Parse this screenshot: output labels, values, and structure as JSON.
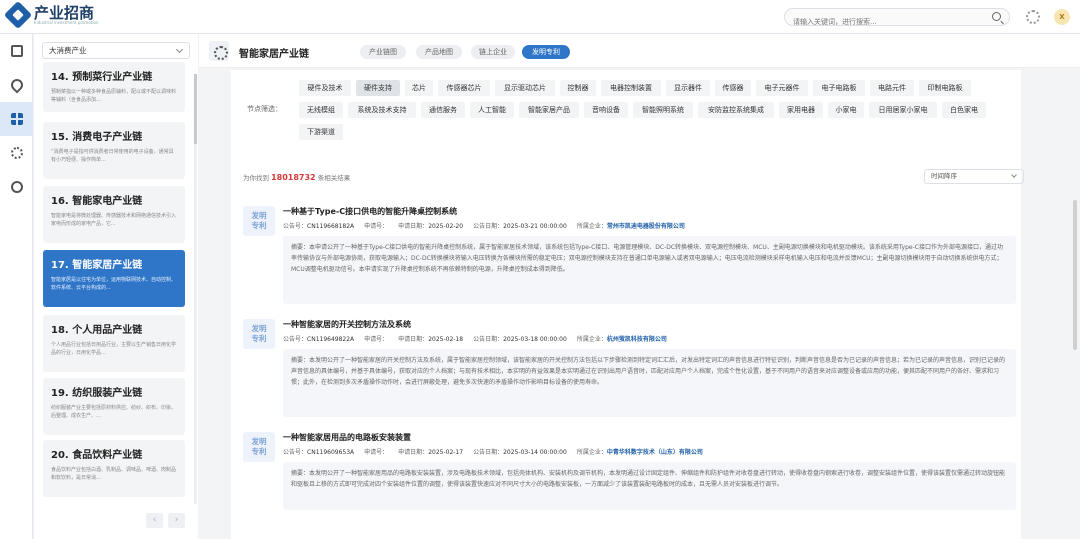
{
  "app": {
    "logo_title": "产业招商",
    "logo_subtitle": "Industrial investment promotion",
    "search_placeholder": "请输入关键词，进行搜索...",
    "avatar": "X"
  },
  "rail": {
    "icons": [
      "dashboard-icon",
      "map-pin-icon",
      "grid-icon",
      "network-icon",
      "eye-icon"
    ],
    "active_index": 2
  },
  "left": {
    "industry_select": "大消费产业",
    "cards": [
      {
        "title": "14. 预制菜行业产业链",
        "desc": "预制菜指以一种或多种食品原辅料，配以或不配以调味料等辅料（含食品添加..."
      },
      {
        "title": "15. 消费电子产业链",
        "desc": "“消费电子是指可供消费者日常使用的电子设备，通常具有小巧轻便、操作简单..."
      },
      {
        "title": "16. 智能家电产业链",
        "desc": "智能家电是将微处理器、传感器技术和网络通信技术引入家电而形成的家电产品，它..."
      },
      {
        "title": "17. 智能家居产业链",
        "desc": "智能家居是以住宅为单位，运用物联网技术、自动控制、软件系统、云平台构成的..."
      },
      {
        "title": "18. 个人用品产业链",
        "desc": "个人用品行业包括日用品行业，主要以生产销售日用化学品的行业，日用化学品..."
      },
      {
        "title": "19. 纺织服装产业链",
        "desc": "纺织服装产业主要包括原材料供应、纺纱、织布、印染、后整理、成衣生产、..."
      },
      {
        "title": "20. 食品饮料产业链",
        "desc": "食品饮料产业包括白酒、乳制品、调味品、啤酒、肉制品和软饮料，是日常消..."
      }
    ],
    "active_card": 3,
    "prev": "‹",
    "next": "›"
  },
  "main": {
    "title": "智能家居产业链",
    "tabs": [
      "产业链图",
      "产品地图",
      "链上企业",
      "发明专利"
    ],
    "active_tab": 3,
    "filter_label": "节点筛选：",
    "chips_row1": [
      "硬件及技术",
      "硬件支持",
      "芯片",
      "传感器芯片",
      "显示驱动芯片",
      "控制器",
      "电器控制装置",
      "显示器件",
      "传感器",
      "电子元器件",
      "电子电路板",
      "电路元件",
      "印制电路板"
    ],
    "chips_row2": [
      "无线模组",
      "系统及技术支持",
      "通信服务",
      "人工智能",
      "智能家居产品",
      "音响设备",
      "智能照明系统",
      "安防监控系统集成",
      "家用电器",
      "小家电",
      "日用居家小家电",
      "白色家电"
    ],
    "chips_row3": [
      "下游渠道"
    ],
    "active_chip": "硬件支持",
    "result_prefix": "为你找到",
    "result_count": "18018732",
    "result_suffix": "条相关结果",
    "sort": "时间降序",
    "patents": [
      {
        "badge": "发明\n专利",
        "title": "一种基于Type-C接口供电的智能升降桌控制系统",
        "pub_no_label": "公告号：",
        "pub_no": "CN119668182A",
        "app_no_label": "申请号：",
        "app_no": "",
        "app_date_label": "申请日期：",
        "app_date": "2025-02-20",
        "pub_date_label": "公告日期：",
        "pub_date": "2025-03-21 00:00:00",
        "company_label": "所属企业：",
        "company": "常州市凯迪电器股份有限公司",
        "abstract": "摘要：本申请公开了一种基于Type-C接口供电的智能升降桌控制系统，属于智能家居技术领域，该系统包括Type-C接口、电源管理模块、DC-DC转换模块、双电源控制模块、MCU、主副电源切换模块和电机驱动模块。该系统采用Type-C接口作为外部电源接口，通过功率传输协议与外部电源协商，获取电源输入；DC-DC转换模块将输入电压转换为各模块所需的稳定电压；双电源控制模块支持在普通口单电源输入或者双电源输入；电压电流检测模块采样电机输入电压和电流并反馈MCU；主副电源切换模块用于自动切换系统供电方式；MCU调整电机驱动信号。本申请实现了升降桌控制系统不再依赖特制的电源，升降桌控制成本得到降低。"
      },
      {
        "badge": "发明\n专利",
        "title": "一种智能家居的开关控制方法及系统",
        "pub_no_label": "公告号：",
        "pub_no": "CN119649822A",
        "app_no_label": "申请号：",
        "app_no": "",
        "app_date_label": "申请日期：",
        "app_date": "2025-02-18",
        "pub_date_label": "公告日期：",
        "pub_date": "2025-03-18 00:00:00",
        "company_label": "所属企业：",
        "company": "杭州萤凯科技有限公司",
        "abstract": "摘要：本发明公开了一种智能家居的开关控制方法及系统，属于智能家居控制领域，该智能家居的开关控制方法包括以下步骤检测到特定词汇汇后，对发出特定词汇的声音信息进行特征识别，判断声音信息是否为已记录的声音信息；若为已记录的声音信息，识别已记录的声音信息的具体编号，并基于具体编号，获取对应的个人档案；与现有技术相比，本实明的有益效果是本实明通过在识别出用户语音时，匹配对应用户个人档案，完成个性化设置，基于不同用户的语音来对应调整设备或应用的功能，便其匹配不同用户的各好、需求和习惯；此外，在检测到多次矛盾操作动作时，会进行屏蔽处理，避免多次快速的矛盾操作动作影响目标设备的使用寿命。"
      },
      {
        "badge": "发明\n专利",
        "title": "一种智能家居用品的电路板安装装置",
        "pub_no_label": "公告号：",
        "pub_no": "CN119609653A",
        "app_no_label": "申请号：",
        "app_no": "",
        "app_date_label": "申请日期：",
        "app_date": "2025-02-17",
        "pub_date_label": "公告日期：",
        "pub_date": "2025-03-14 00:00:00",
        "company_label": "所属企业：",
        "company": "中青华科数字技术（山东）有限公司",
        "abstract": "摘要：本发明公开了一种智能家居用品的电路板安装装置，涉及电路板技术领域，包括壳体机构、安装机构及调节机构，本发明通过设计固定组件、伸缩组件和防护组件对收卷盘进行转动，使得收卷盘内钢索进行收卷，调整安装组件位置，使得该装置仅需通过转动旋钮能和驱板且上移的方式即可完成对四个安装组件位置的调整，使得该装置快速应对不同尺寸大小的电路板安装板，一方面减少了该装置装配电路板时的成本，且无需人员对安装板进行调节。"
      }
    ]
  }
}
